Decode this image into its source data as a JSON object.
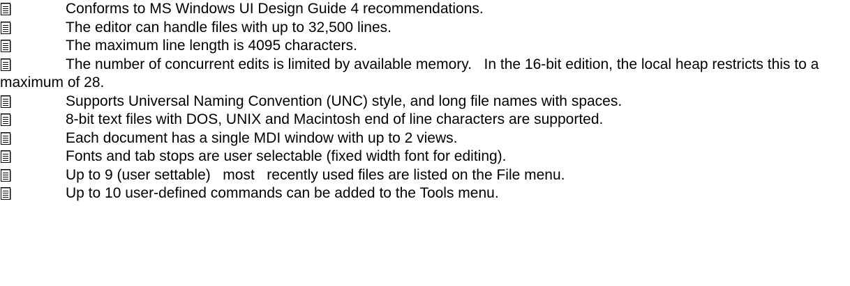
{
  "bullet_icon": "text-document-icon",
  "items": [
    "Conforms to MS Windows UI Design Guide 4 recommendations.",
    "The editor can handle files with up to 32,500 lines.",
    "The maximum line length is 4095 characters.",
    "The number of concurrent edits is limited by available memory.   In the 16-bit edition, the local heap restricts this to a maximum of 28.",
    "Supports Universal Naming Convention (UNC) style, and long file names with spaces.",
    "8-bit text files with DOS, UNIX and Macintosh end of line characters are supported.",
    "Each document has a single MDI window with up to 2 views.",
    "Fonts and tab stops are user selectable (fixed width font for editing).",
    "Up to 9 (user settable)   most   recently used files are listed on the File menu.",
    "Up to 10 user-defined commands can be added to the Tools menu."
  ]
}
